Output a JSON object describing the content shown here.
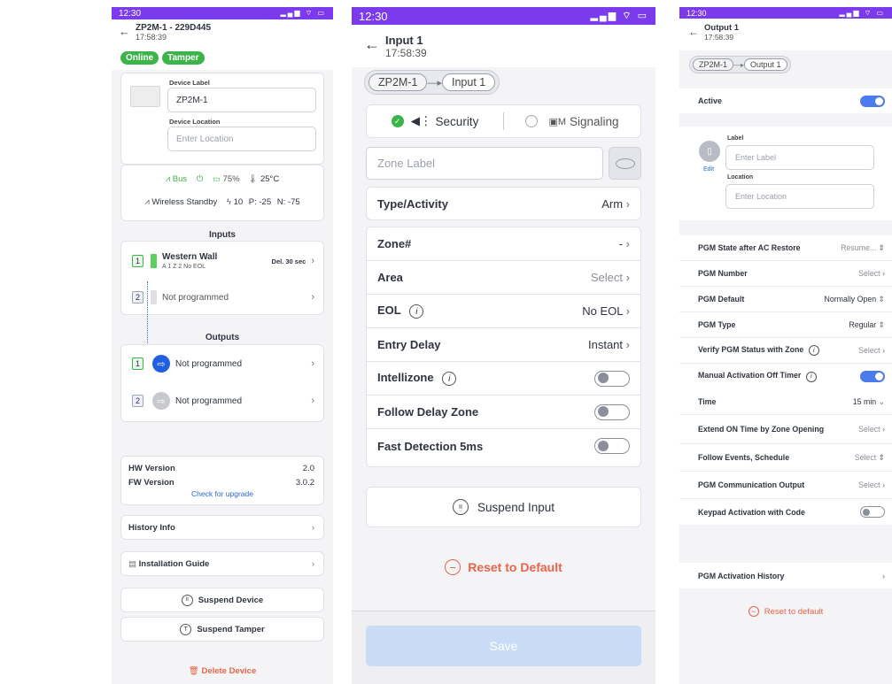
{
  "screen1": {
    "time": "12:30",
    "status_icons": "▂▄▆ ⌔ ▭",
    "title": "ZP2M-1 - 229D445",
    "subtitle": "17:58:39",
    "badges": [
      "Online",
      "Tamper"
    ],
    "device_label_caption": "Device Label",
    "device_label_value": "ZP2M-1",
    "device_location_caption": "Device Location",
    "device_location_placeholder": "Enter Location",
    "status1": "Bus",
    "battery": "75%",
    "temp": "25°C",
    "status2": "Wireless Standby",
    "signal": "10",
    "p_value": "P: -25",
    "n_value": "N: -75",
    "inputs_title": "Inputs",
    "input1_num": "1",
    "input1_name": "Western Wall",
    "input1_tags": "A 1  Z 2   No EOL",
    "input1_delay": "Del. 30 sec",
    "input2_num": "2",
    "input2_name": "Not programmed",
    "outputs_title": "Outputs",
    "output1_num": "1",
    "output1_name": "Not programmed",
    "output2_num": "2",
    "output2_name": "Not programmed",
    "hw_label": "HW Version",
    "hw_value": "2.0",
    "fw_label": "FW Version",
    "fw_value": "3.0.2",
    "check_upgrade": "Check for upgrade",
    "history_info": "History Info",
    "install_guide": "Installation Guide",
    "suspend_device": "Suspend Device",
    "suspend_tamper": "Suspend Tamper",
    "delete_device": "Delete Device",
    "colors": {
      "green": "#3bb449",
      "blue": "#2b6ad8",
      "orange": "#e8644a"
    }
  },
  "screen2": {
    "time": "12:30",
    "status_icons": "▂▄▆ ⌔ ▭",
    "title": "Input 1",
    "subtitle": "17:58:39",
    "crumbs": [
      "ZP2M-1",
      "Input 1"
    ],
    "tab_security": "Security",
    "tab_signaling": "Signaling",
    "zone_label_placeholder": "Zone Label",
    "rows": {
      "type_label": "Type/Activity",
      "type_value": "Arm",
      "zone_label": "Zone#",
      "zone_value": "-",
      "area_label": "Area",
      "area_value": "Select",
      "eol_label": "EOL",
      "eol_value": "No EOL",
      "entry_label": "Entry Delay",
      "entry_value": "Instant",
      "intellizone_label": "Intellizone",
      "follow_label": "Follow Delay Zone",
      "fast_label": "Fast Detection 5ms"
    },
    "suspend_input": "Suspend Input",
    "reset_default": "Reset to Default",
    "save": "Save"
  },
  "screen3": {
    "time": "12:30",
    "status_icons": "▂▄▆ ⌔ ▭",
    "title": "Output 1",
    "subtitle": "17:58:39",
    "crumbs": [
      "ZP2M-1",
      "Output 1"
    ],
    "active_label": "Active",
    "edit": "Edit",
    "label_caption": "Label",
    "label_placeholder": "Enter Label",
    "location_caption": "Location",
    "location_placeholder": "Enter Location",
    "rows": {
      "r1_label": "PGM State after AC Restore",
      "r1_value": "Resume...",
      "r2_label": "PGM Number",
      "r2_value": "Select",
      "r3_label": "PGM Default",
      "r3_value": "Normally Open",
      "r4_label": "PGM Type",
      "r4_value": "Regular",
      "r5_label": "Verify PGM Status with Zone",
      "r5_value": "Select",
      "r6_label": "Manual Activation Off Timer",
      "r7_label": "Time",
      "r7_value": "15 min",
      "r8_label": "Extend ON Time by Zone Opening",
      "r8_value": "Select",
      "r9_label": "Follow Events, Schedule",
      "r9_value": "Select",
      "r10_label": "PGM Communication Output",
      "r10_value": "Select",
      "r11_label": "Keypad Activation with Code",
      "r12_label": "PGM Activation History"
    },
    "reset_default": "Reset to default"
  }
}
